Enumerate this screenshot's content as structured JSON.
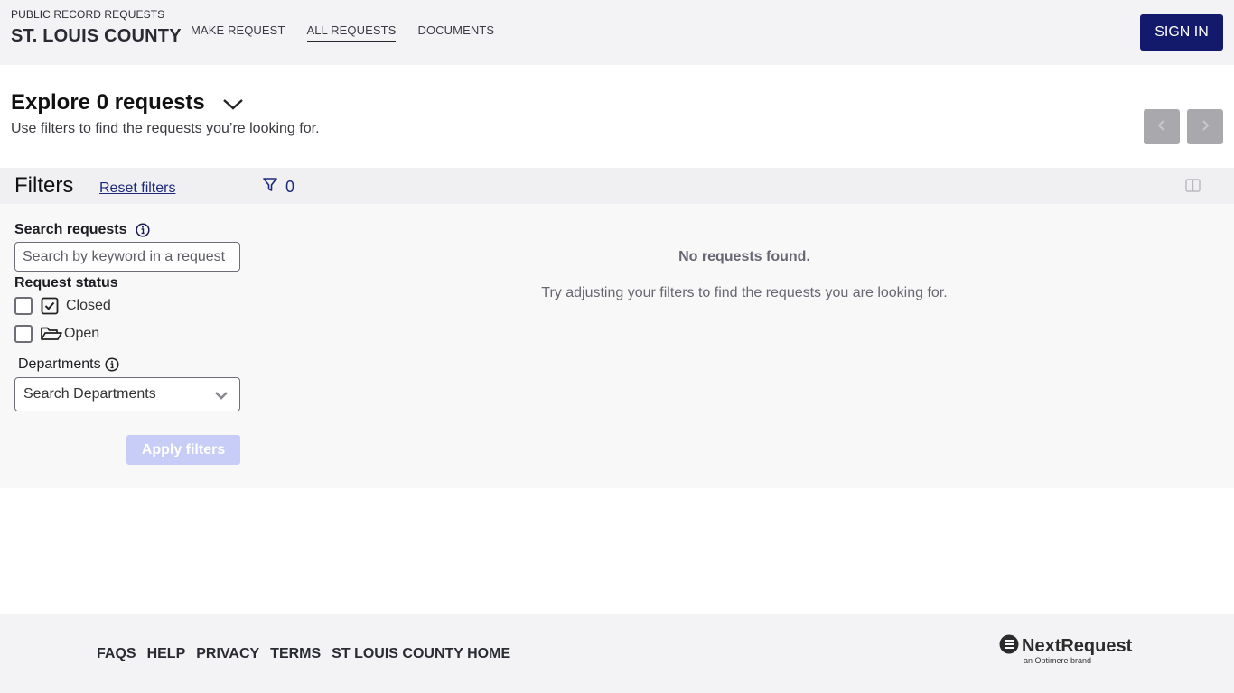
{
  "header": {
    "subtitle": "PUBLIC RECORD REQUESTS",
    "title": "ST. LOUIS COUNTY",
    "nav": [
      {
        "label": "MAKE REQUEST",
        "active": false
      },
      {
        "label": "ALL REQUESTS",
        "active": true
      },
      {
        "label": "DOCUMENTS",
        "active": false
      }
    ],
    "sign_in_label": "SIGN IN",
    "accent_color": "#131a6b"
  },
  "explore": {
    "title": "Explore 0 requests",
    "subtitle": "Use filters to find the requests you’re looking for.",
    "prev_icon": "chevron-left-icon",
    "next_icon": "chevron-right-icon"
  },
  "filters": {
    "title": "Filters",
    "reset_label": "Reset filters",
    "active_count": "0",
    "search": {
      "label": "Search requests",
      "placeholder": "Search by keyword in a request",
      "value": ""
    },
    "status": {
      "label": "Request status",
      "options": [
        {
          "label": "Closed",
          "icon": "check-square-icon",
          "checked": false
        },
        {
          "label": "Open",
          "icon": "folder-open-icon",
          "checked": false
        }
      ]
    },
    "departments": {
      "label": "Departments",
      "placeholder": "Search Departments"
    },
    "apply_label": "Apply filters"
  },
  "results": {
    "empty_title": "No requests found.",
    "empty_message": "Try adjusting your filters to find the requests you are looking for."
  },
  "footer": {
    "links": [
      "FAQS",
      "HELP",
      "PRIVACY",
      "TERMS",
      "ST LOUIS COUNTY HOME"
    ],
    "brand_name": "NextRequest",
    "brand_tagline": "an Optimere brand"
  }
}
